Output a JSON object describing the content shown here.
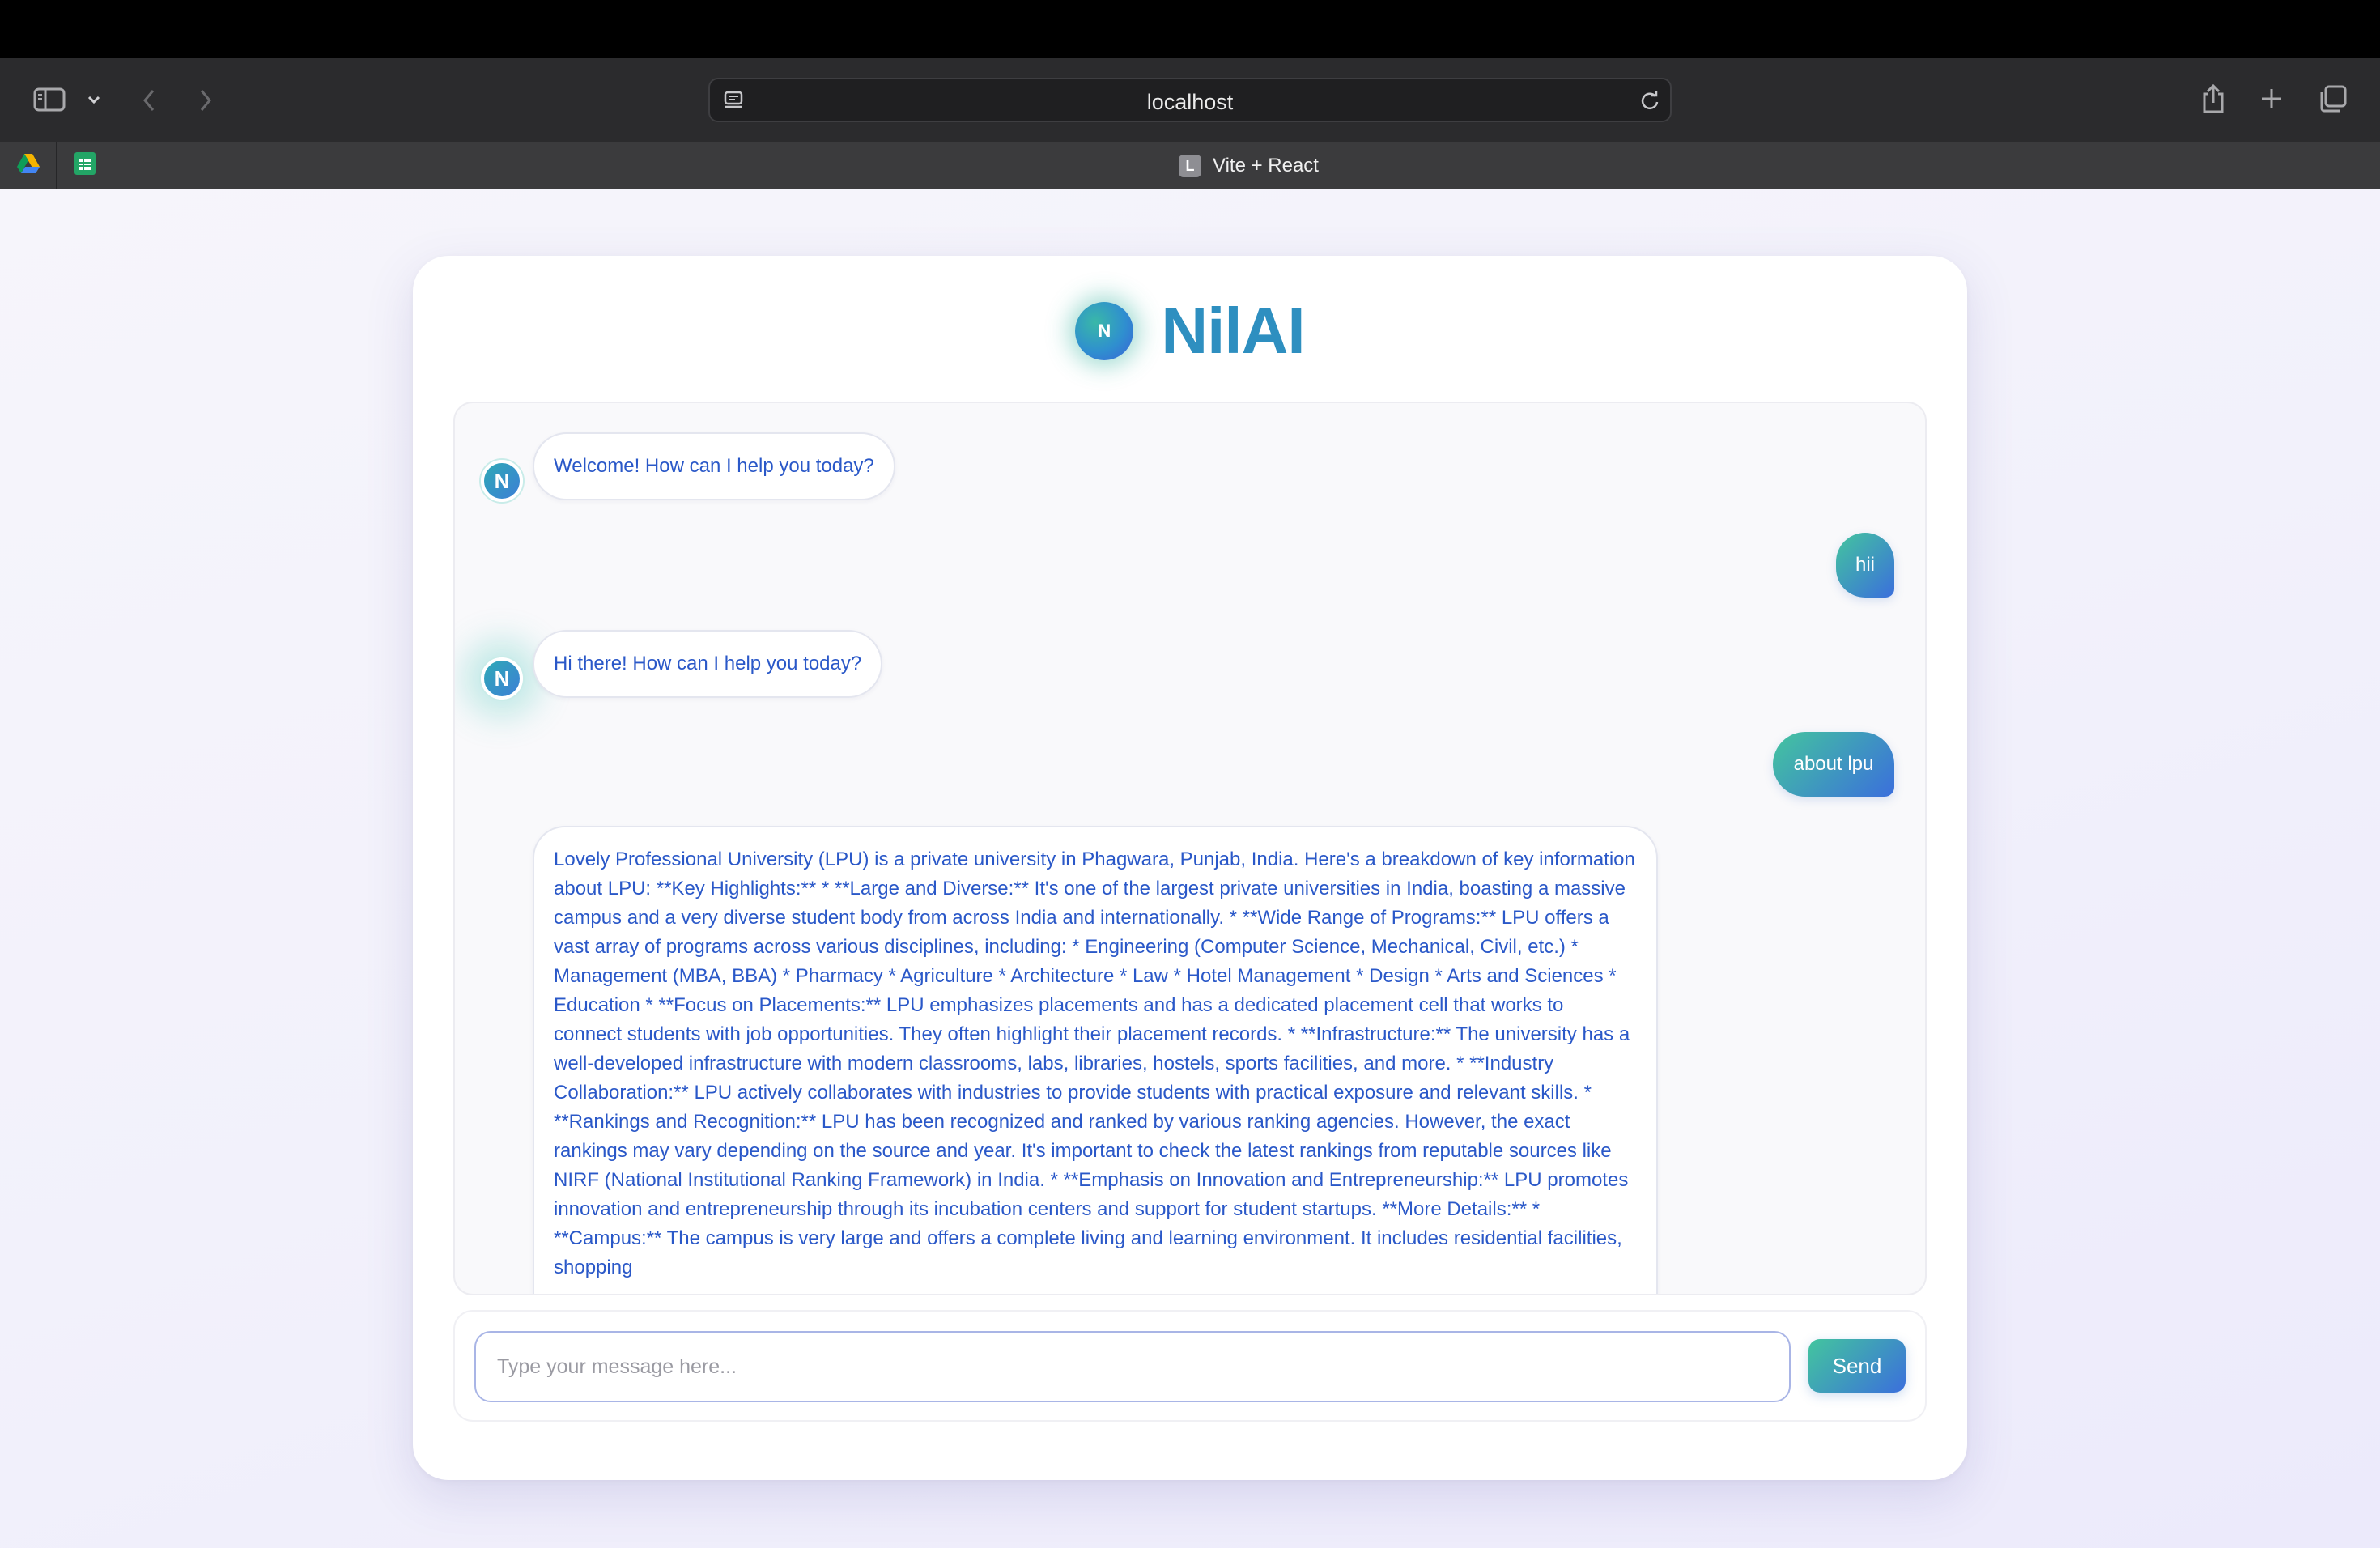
{
  "browser": {
    "url": "localhost",
    "active_tab_title": "Vite + React",
    "active_tab_favicon_letter": "L",
    "pinned_tabs": [
      {
        "icon": "google-drive-icon"
      },
      {
        "icon": "google-sheets-icon"
      }
    ]
  },
  "app": {
    "logo_letter": "N",
    "name": "NilAI",
    "avatar_letter": "N"
  },
  "messages": [
    {
      "role": "bot",
      "text": "Welcome! How can I help you today?"
    },
    {
      "role": "user",
      "text": "hii"
    },
    {
      "role": "bot",
      "text": "Hi there! How can I help you today?"
    },
    {
      "role": "user",
      "text": "about lpu"
    },
    {
      "role": "bot",
      "text": "Lovely Professional University (LPU) is a private university in Phagwara, Punjab, India. Here's a breakdown of key information about LPU: **Key Highlights:** * **Large and Diverse:** It's one of the largest private universities in India, boasting a massive campus and a very diverse student body from across India and internationally. * **Wide Range of Programs:** LPU offers a vast array of programs across various disciplines, including: * Engineering (Computer Science, Mechanical, Civil, etc.) * Management (MBA, BBA) * Pharmacy * Agriculture * Architecture * Law * Hotel Management * Design * Arts and Sciences * Education * **Focus on Placements:** LPU emphasizes placements and has a dedicated placement cell that works to connect students with job opportunities. They often highlight their placement records. * **Infrastructure:** The university has a well-developed infrastructure with modern classrooms, labs, libraries, hostels, sports facilities, and more. * **Industry Collaboration:** LPU actively collaborates with industries to provide students with practical exposure and relevant skills. * **Rankings and Recognition:** LPU has been recognized and ranked by various ranking agencies. However, the exact rankings may vary depending on the source and year. It's important to check the latest rankings from reputable sources like NIRF (National Institutional Ranking Framework) in India. * **Emphasis on Innovation and Entrepreneurship:** LPU promotes innovation and entrepreneurship through its incubation centers and support for student startups. **More Details:** * **Campus:** The campus is very large and offers a complete living and learning environment. It includes residential facilities, shopping"
    }
  ],
  "composer": {
    "placeholder": "Type your message here...",
    "value": "",
    "send_label": "Send"
  },
  "colors": {
    "brand": "#2e8fc0",
    "bot_text": "#2a58c8",
    "gradient_start": "#43c59e",
    "gradient_end": "#3b6fdc"
  }
}
